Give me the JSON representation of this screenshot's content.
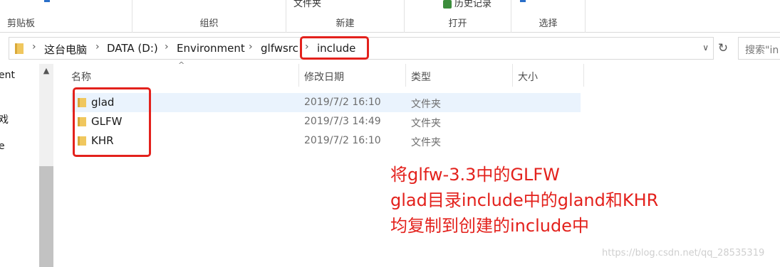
{
  "ribbon": {
    "clipboard": "剪贴板",
    "organize": "组织",
    "new": "新建",
    "new_top": "文件夹",
    "open": "打开",
    "open_top": "历史记录",
    "select": "选择"
  },
  "address": {
    "crumbs": [
      "这台电脑",
      "DATA (D:)",
      "Environment",
      "glfwsrc",
      "include"
    ],
    "search_placeholder": "搜索\"in"
  },
  "nav": {
    "items": [
      "ent",
      "戏",
      "e"
    ]
  },
  "columns": [
    "名称",
    "修改日期",
    "类型",
    "大小"
  ],
  "files": [
    {
      "name": "glad",
      "date": "2019/7/2 16:10",
      "type": "文件夹"
    },
    {
      "name": "GLFW",
      "date": "2019/7/3 14:49",
      "type": "文件夹"
    },
    {
      "name": "KHR",
      "date": "2019/7/2 16:10",
      "type": "文件夹"
    }
  ],
  "annotation": {
    "lines": [
      "将glfw-3.3中的GLFW",
      "glad目录include中的gland和KHR",
      "均复制到创建的include中"
    ],
    "color": "#e3211c"
  },
  "watermark": "https://blog.csdn.net/qq_28535319"
}
